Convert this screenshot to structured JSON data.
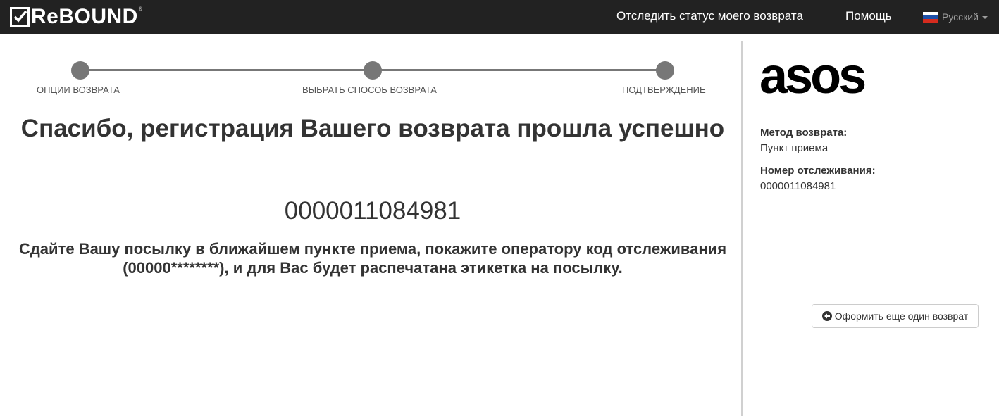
{
  "header": {
    "logo_text": "ReBOUND",
    "logo_registered": "®",
    "nav": {
      "track_label": "Отследить статус моего возврата",
      "help_label": "Помощь"
    },
    "language": {
      "selected": "Русский",
      "flag_colors": [
        "#ffffff",
        "#1c4fa8",
        "#d52b1e"
      ]
    }
  },
  "steps": [
    {
      "label": "ОПЦИИ ВОЗВРАТА"
    },
    {
      "label": "ВЫБРАТЬ СПОСОБ ВОЗВРАТА"
    },
    {
      "label": "ПОДТВЕРЖДЕНИЕ"
    }
  ],
  "confirmation": {
    "title": "Спасибо, регистрация Вашего возврата прошла успешно",
    "tracking_number": "0000011084981",
    "instructions": "Сдайте Вашу посылку в ближайшем пункте приема, покажите оператору код отслеживания (00000********), и для Вас будет распечатана этикетка на посылку."
  },
  "sidebar": {
    "brand_logo_text": "asos",
    "method_label": "Метод возврата:",
    "method_value": "Пункт приема",
    "tracking_label": "Номер отслеживания:",
    "tracking_value": "0000011084981",
    "new_return_button": "Оформить еще один возврат"
  },
  "colors": {
    "navbar_bg": "#222222",
    "step_color": "#777777",
    "text": "#333333"
  }
}
